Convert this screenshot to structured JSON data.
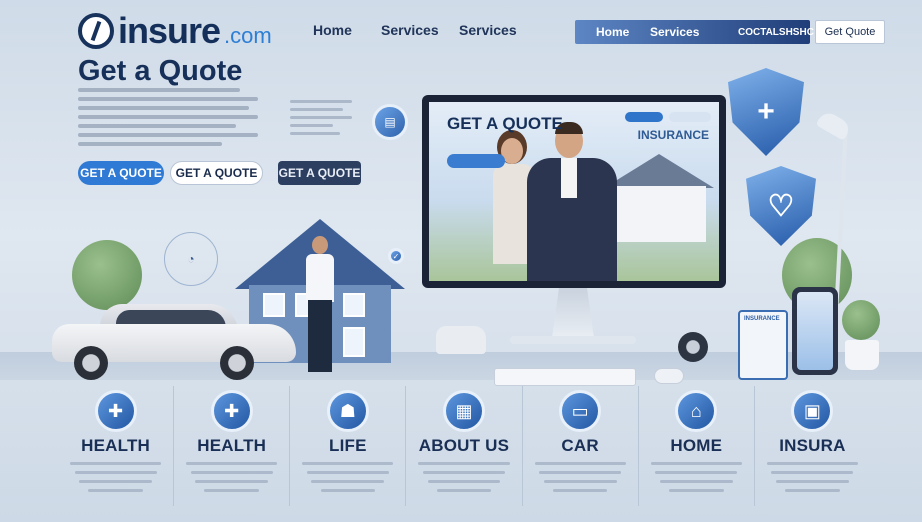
{
  "header": {
    "logo_main": "insure",
    "logo_suffix": ".com",
    "nav_primary": [
      "Home",
      "Services",
      "Services"
    ],
    "nav_secondary": [
      "Home",
      "Services",
      "COCTALSHSHC"
    ],
    "quote_button": "Get Quote"
  },
  "hero": {
    "title": "Get a Quote",
    "buttons": [
      "GET A QUOTE",
      "GET A QUOTE",
      "GET A QUOTE"
    ]
  },
  "monitor": {
    "screen_title": "GET A QUOTE",
    "screen_brand": "INSURANCE"
  },
  "tablet_label": "INSURANCE",
  "categories": [
    {
      "label": "HEALTH",
      "icon": "medical-icon"
    },
    {
      "label": "HEALTH",
      "icon": "medical-icon"
    },
    {
      "label": "LIFE",
      "icon": "family-icon"
    },
    {
      "label": "ABOUT US",
      "icon": "building-icon"
    },
    {
      "label": "CAR",
      "icon": "car-icon"
    },
    {
      "label": "HOME",
      "icon": "house-icon"
    },
    {
      "label": "INSURA",
      "icon": "briefcase-icon"
    }
  ],
  "colors": {
    "brand_navy": "#14305a",
    "accent_blue": "#2f7ad4"
  }
}
